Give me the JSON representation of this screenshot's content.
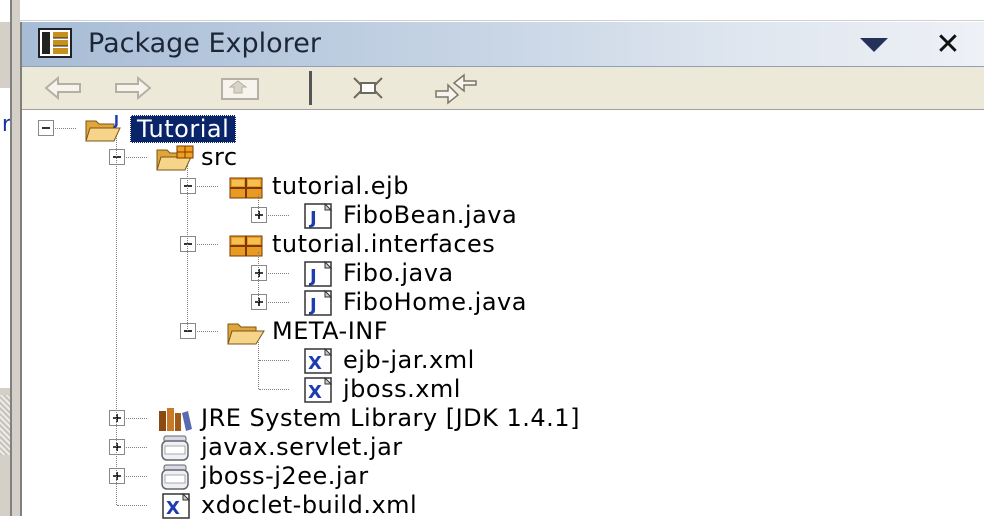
{
  "view": {
    "title": "Package Explorer",
    "close_glyph": "✕"
  },
  "toolbar": {
    "buttons": [
      "back-icon",
      "forward-icon",
      "up-icon",
      "collapse-all-icon",
      "link-with-editor-icon"
    ]
  },
  "tree": {
    "items": [
      {
        "label": "Tutorial",
        "icon": "java-project-icon",
        "toggle": "collapse",
        "selected": true
      },
      {
        "label": "src",
        "icon": "source-folder-icon",
        "toggle": "collapse"
      },
      {
        "label": "tutorial.ejb",
        "icon": "package-icon",
        "toggle": "collapse"
      },
      {
        "label": "FiboBean.java",
        "icon": "java-file-icon",
        "toggle": "expand"
      },
      {
        "label": "tutorial.interfaces",
        "icon": "package-icon",
        "toggle": "collapse"
      },
      {
        "label": "Fibo.java",
        "icon": "java-file-icon",
        "toggle": "expand"
      },
      {
        "label": "FiboHome.java",
        "icon": "java-file-icon",
        "toggle": "expand"
      },
      {
        "label": "META-INF",
        "icon": "folder-icon",
        "toggle": "collapse"
      },
      {
        "label": "ejb-jar.xml",
        "icon": "xml-file-icon",
        "toggle": "none"
      },
      {
        "label": "jboss.xml",
        "icon": "xml-file-icon",
        "toggle": "none"
      },
      {
        "label": "JRE System Library [JDK 1.4.1]",
        "icon": "library-icon",
        "toggle": "expand"
      },
      {
        "label": "javax.servlet.jar",
        "icon": "jar-icon",
        "toggle": "expand"
      },
      {
        "label": "jboss-j2ee.jar",
        "icon": "jar-icon",
        "toggle": "expand"
      },
      {
        "label": "xdoclet-build.xml",
        "icon": "xml-file-icon",
        "toggle": "none"
      }
    ]
  },
  "editor_fragment": {
    "text": "r"
  },
  "colors": {
    "selection": "#0a246a",
    "title_gradient_start": "#a7bcd6",
    "toolbar": "#ece9d8"
  }
}
